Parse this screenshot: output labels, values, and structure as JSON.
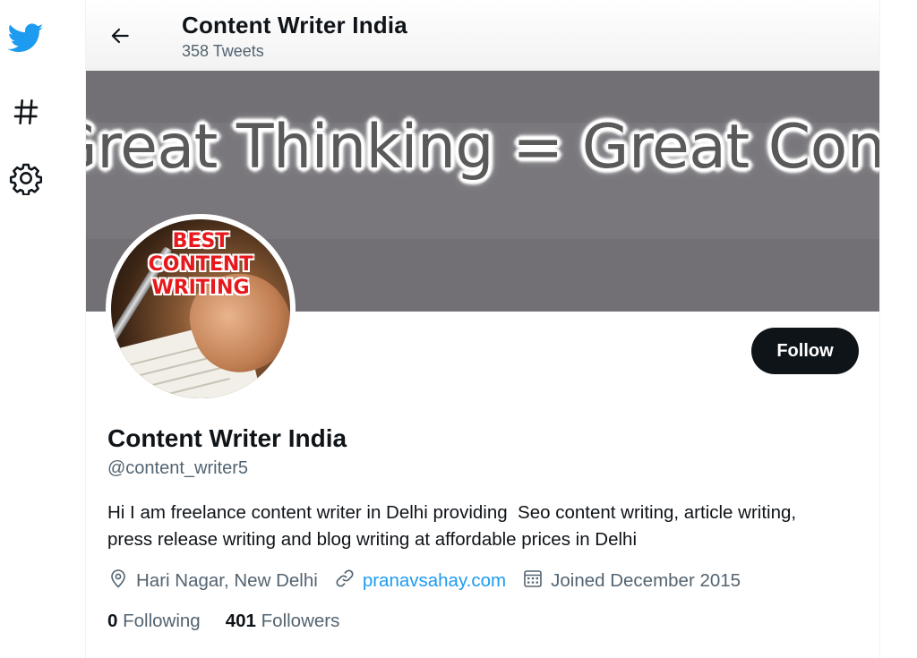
{
  "sidebar": {
    "items": [
      {
        "icon": "twitter-bird-icon",
        "color": "#1d9bf0"
      },
      {
        "icon": "hashtag-icon"
      },
      {
        "icon": "gear-icon"
      }
    ]
  },
  "header": {
    "title": "Content Writer India",
    "subtitle": "358 Tweets",
    "back_icon": "back-arrow-icon"
  },
  "banner": {
    "text": "Great Thinking = Great Content"
  },
  "avatar": {
    "lines": [
      "BEST",
      "CONTENT",
      "WRITING"
    ]
  },
  "profile": {
    "follow_label": "Follow",
    "name": "Content Writer India",
    "handle": "@content_writer5",
    "bio": "Hi I am freelance content writer in Delhi providing  Seo content writing, article writing, press release writing and blog writing at affordable prices in Delhi",
    "location": "Hari Nagar, New Delhi",
    "website": "pranavsahay.com",
    "joined": "Joined December 2015",
    "following_count": "0",
    "following_label": "Following",
    "followers_count": "401",
    "followers_label": "Followers"
  },
  "colors": {
    "accent": "#1d9bf0",
    "text": "#0f1419",
    "secondary": "#536471",
    "button_bg": "#0f1419"
  }
}
